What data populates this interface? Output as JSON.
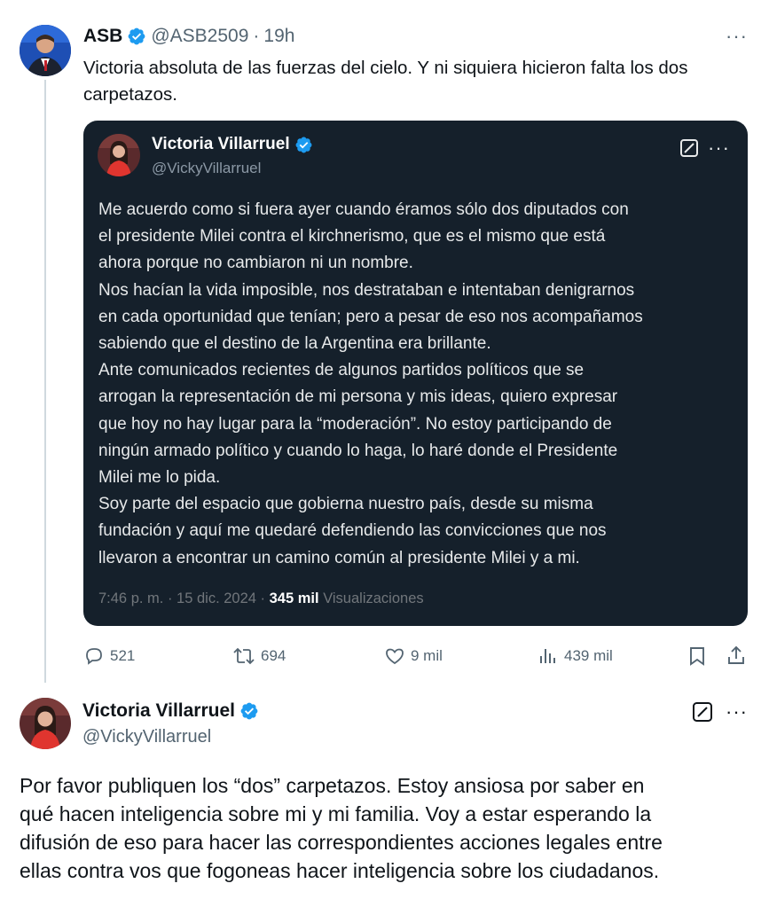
{
  "tweet": {
    "author_name": "ASB",
    "handle": "@ASB2509",
    "separator": "·",
    "time": "19h",
    "text": "Victoria absoluta de las fuerzas del cielo. Y ni siquiera hicieron falta los dos carpetazos.",
    "more_icon": "more-dots-icon"
  },
  "quoted": {
    "author_name": "Victoria Villarruel",
    "handle": "@VickyVillarruel",
    "body": "Me acuerdo como si fuera ayer cuando éramos sólo dos diputados con\nel presidente Milei contra el kirchnerismo, que es el mismo que está\nahora porque no cambiaron ni un nombre.\nNos hacían la vida imposible, nos destrataban e intentaban denigrarnos\nen cada oportunidad que tenían; pero a pesar de eso nos acompañamos\nsabiendo que el destino de la Argentina era brillante.\nAnte comunicados recientes de algunos partidos políticos que se\narrogan la representación de mi persona y mis ideas, quiero expresar\nque hoy no hay lugar para la “moderación”.  No estoy participando de\nningún armado político y cuando lo haga, lo haré donde el Presidente\nMilei me lo pida.\nSoy parte del espacio que gobierna nuestro país, desde su misma\nfundación y aquí me quedaré defendiendo las convicciones que nos\nllevaron a encontrar un camino común al presidente Milei y a mi.",
    "timestamp": "7:46 p. m. · 15 dic. 2024 ·",
    "views_count": "345 mil",
    "views_label": "Visualizaciones"
  },
  "actions": {
    "replies": "521",
    "reposts": "694",
    "likes": "9 mil",
    "views": "439 mil"
  },
  "reply": {
    "author_name": "Victoria Villarruel",
    "handle": "@VickyVillarruel",
    "text": "Por favor publiquen los “dos” carpetazos. Estoy ansiosa por saber en\nqué hacen inteligencia sobre mi y mi familia. Voy a estar esperando la\ndifusión de eso para hacer las correspondientes acciones legales entre\nellas contra vos que fogoneas hacer inteligencia sobre los ciudadanos."
  },
  "colors": {
    "verified": "#1d9bf0",
    "card_bg": "#15202b",
    "muted": "#536471"
  }
}
